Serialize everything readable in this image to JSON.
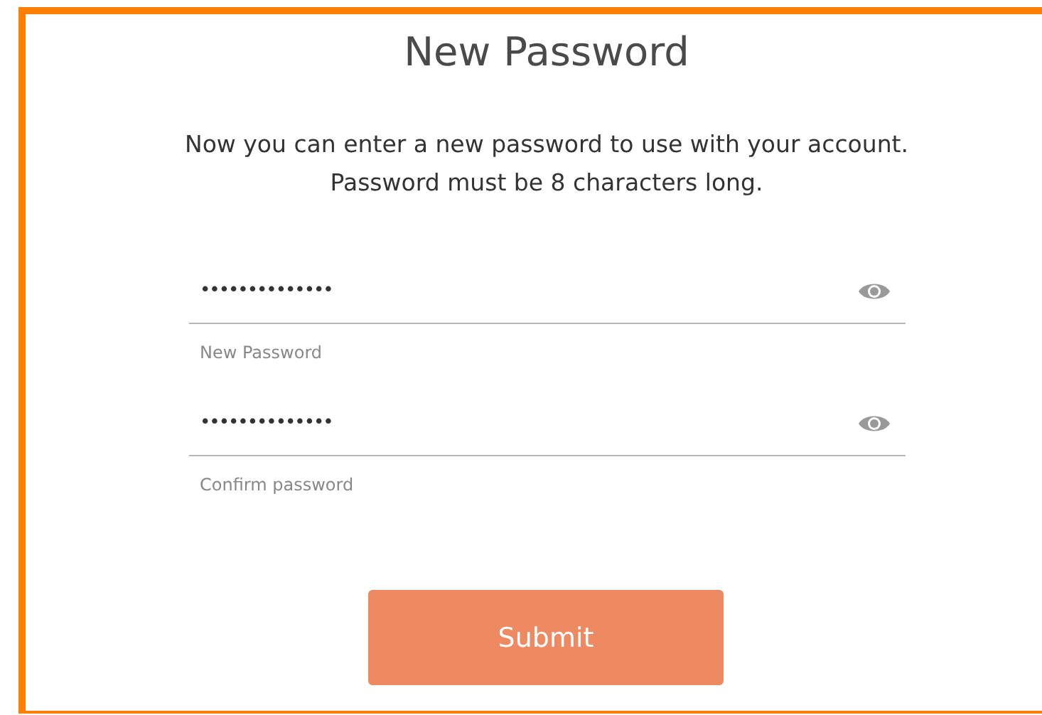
{
  "title": "New Password",
  "description": [
    "Now you can enter a new password to use with your account.",
    "Password must be 8 characters long."
  ],
  "fields": [
    {
      "value": "••••••••••••••",
      "label": "New Password"
    },
    {
      "value": "••••••••••••••",
      "label": "Confirm password"
    }
  ],
  "submit_button": "Submit"
}
